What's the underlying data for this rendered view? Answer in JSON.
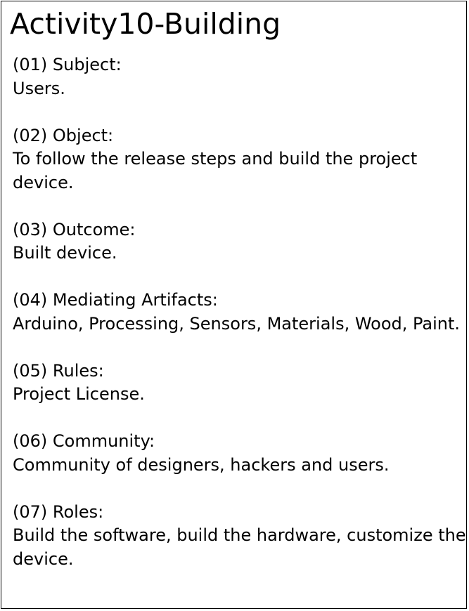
{
  "title": "Activity10-Building",
  "sections": [
    {
      "label": "(01) Subject:",
      "value": "Users."
    },
    {
      "label": "(02) Object:",
      "value": "To follow the release steps and build the project device."
    },
    {
      "label": "(03) Outcome:",
      "value": "Built device."
    },
    {
      "label": "(04) Mediating Artifacts:",
      "value": "Arduino, Processing, Sensors, Materials, Wood, Paint."
    },
    {
      "label": "(05) Rules:",
      "value": "Project License."
    },
    {
      "label": "(06) Community:",
      "value": "Community of designers, hackers and users."
    },
    {
      "label": "(07) Roles:",
      "value": "Build the software, build the hardware, customize the device."
    }
  ]
}
